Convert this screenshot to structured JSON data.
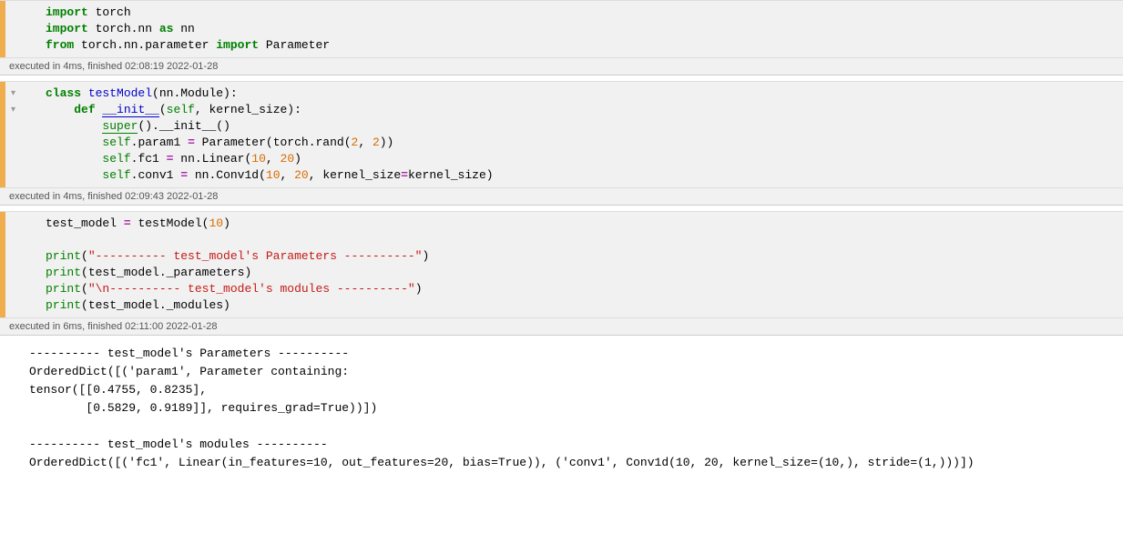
{
  "cells": [
    {
      "fold": "",
      "code": {
        "line1_kw1": "import",
        "line1_mod": " torch",
        "line2_kw1": "import",
        "line2_mod": " torch.nn ",
        "line2_kw2": "as",
        "line2_mod2": " nn",
        "line3_kw1": "from",
        "line3_mod": " torch.nn.parameter ",
        "line3_kw2": "import",
        "line3_mod2": " Parameter"
      },
      "status": "executed in 4ms, finished 02:08:19 2022-01-28"
    },
    {
      "fold": "▾\n▾",
      "code": {
        "l1a": "class",
        "l1b": " ",
        "l1c": "testModel",
        "l1d": "(nn.Module):",
        "l2a": "    ",
        "l2b": "def",
        "l2c": " ",
        "l2d": "__init__",
        "l2e": "(",
        "l2f": "self",
        "l2g": ", kernel_size):",
        "l3a": "        ",
        "l3b": "super",
        "l3c": "().",
        "l3d": "__init__",
        "l3e": "()",
        "l4a": "        ",
        "l4b": "self",
        "l4c": ".param1 ",
        "l4d": "=",
        "l4e": " Parameter(torch.rand(",
        "l4f": "2",
        "l4g": ", ",
        "l4h": "2",
        "l4i": "))",
        "l5a": "        ",
        "l5b": "self",
        "l5c": ".fc1 ",
        "l5d": "=",
        "l5e": " nn.Linear(",
        "l5f": "10",
        "l5g": ", ",
        "l5h": "20",
        "l5i": ")",
        "l6a": "        ",
        "l6b": "self",
        "l6c": ".conv1 ",
        "l6d": "=",
        "l6e": " nn.Conv1d(",
        "l6f": "10",
        "l6g": ", ",
        "l6h": "20",
        "l6i": ", kernel_size",
        "l6j": "=",
        "l6k": "kernel_size)"
      },
      "status": "executed in 4ms, finished 02:09:43 2022-01-28"
    },
    {
      "fold": "",
      "code": {
        "r1a": "test_model ",
        "r1b": "=",
        "r1c": " testModel(",
        "r1d": "10",
        "r1e": ")",
        "r3a": "print",
        "r3b": "(",
        "r3c": "\"---------- test_model's Parameters ----------\"",
        "r3d": ")",
        "r4a": "print",
        "r4b": "(test_model._parameters)",
        "r5a": "print",
        "r5b": "(",
        "r5c": "\"\\n---------- test_model's modules ----------\"",
        "r5d": ")",
        "r6a": "print",
        "r6b": "(test_model._modules)"
      },
      "status": "executed in 6ms, finished 02:11:00 2022-01-28"
    }
  ],
  "output": "---------- test_model's Parameters ----------\nOrderedDict([('param1', Parameter containing:\ntensor([[0.4755, 0.8235],\n        [0.5829, 0.9189]], requires_grad=True))])\n\n---------- test_model's modules ----------\nOrderedDict([('fc1', Linear(in_features=10, out_features=20, bias=True)), ('conv1', Conv1d(10, 20, kernel_size=(10,), stride=(1,)))])"
}
